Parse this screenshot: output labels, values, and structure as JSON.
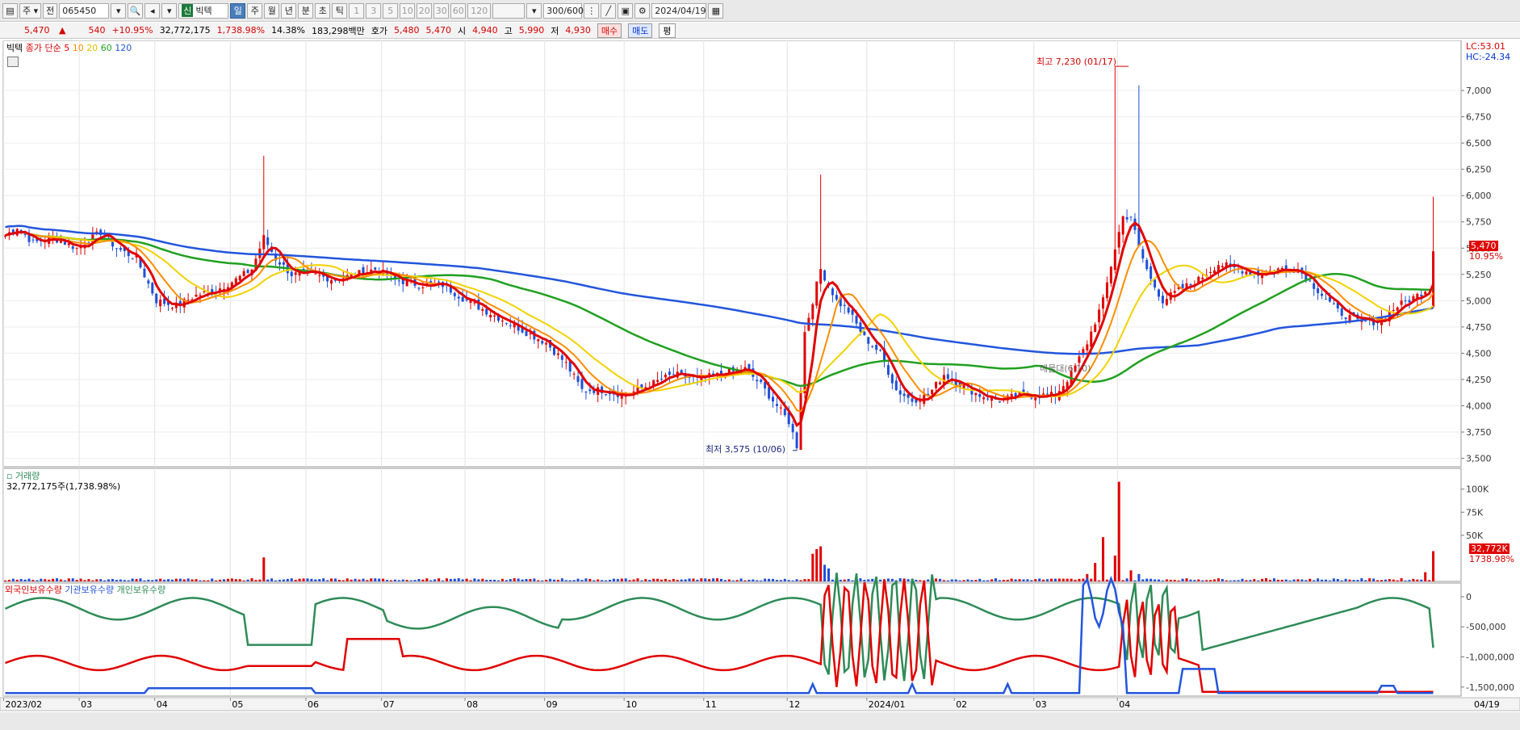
{
  "toolbar": {
    "period_type": "주",
    "code_prefix": "전",
    "stock_code": "065450",
    "market_badge": "신",
    "stock_name": "빅텍",
    "periods": [
      "일",
      "주",
      "월",
      "년",
      "분",
      "초",
      "틱"
    ],
    "selected_period": "일",
    "intervals": [
      "1",
      "3",
      "5",
      "10",
      "20",
      "30",
      "60",
      "120"
    ],
    "count": "300/600",
    "date": "2024/04/19"
  },
  "info": {
    "price": "5,470",
    "change": "540",
    "change_pct": "+10.95%",
    "volume": "32,772,175",
    "volume_ratio": "1,738.98%",
    "turnover": "14.38%",
    "amount": "183,298백만",
    "quote_label": "호가",
    "ask": "5,480",
    "bid": "5,470",
    "open_label": "시",
    "open": "4,940",
    "high_label": "고",
    "high": "5,990",
    "low_label": "저",
    "low": "4,930",
    "buy_button": "매수",
    "sell_button": "매도",
    "eval_button": "평"
  },
  "price_panel": {
    "legend_name": "빅텍",
    "legend_ma_label": "종가 단순",
    "ma_periods": [
      "5",
      "10",
      "20",
      "60",
      "120"
    ],
    "ma_colors": [
      "#e00000",
      "#ff8c00",
      "#f2d200",
      "#20a020",
      "#2255dd"
    ],
    "lc": "LC:53.01",
    "hc": "HC:-24.34",
    "max_label": "최고 7,230 (01/17)",
    "min_label": "최저 3,575 (10/06)",
    "faint_label": "매물대(6,10)",
    "current_price": "5,470",
    "current_pct": "10.95%"
  },
  "volume_panel": {
    "title": "거래량",
    "subtitle": "32,772,175주(1,738.98%)",
    "current": "32,772K",
    "current_pct": "1738.98%"
  },
  "holdings_panel": {
    "legends": [
      "외국인보유수량",
      "기관보유수량",
      "개인보유수량"
    ],
    "legend_colors": [
      "#e00000",
      "#2255dd",
      "#2e8b57"
    ]
  },
  "x_axis": {
    "labels": [
      "2023/02",
      "03",
      "04",
      "05",
      "06",
      "07",
      "08",
      "09",
      "10",
      "11",
      "12",
      "2024/01",
      "02",
      "03",
      "04"
    ],
    "end_label": "04/19"
  },
  "chart_data": {
    "type": "candlestick",
    "price_axis": {
      "ticks": [
        3500,
        3750,
        4000,
        4250,
        4500,
        4750,
        5000,
        5250,
        5500,
        5750,
        6000,
        6250,
        6500,
        6750,
        7000
      ],
      "range": [
        3420,
        7400
      ]
    },
    "volume_axis": {
      "ticks": [
        50000,
        75000,
        100000
      ],
      "unit": "K",
      "range": [
        0,
        112000
      ]
    },
    "holdings_axis": {
      "ticks": [
        0,
        -500000,
        -1000000,
        -1500000
      ],
      "range": [
        -1650000,
        120000
      ]
    },
    "anchors": [
      [
        0,
        5620
      ],
      [
        3,
        5700
      ],
      [
        7,
        5550
      ],
      [
        12,
        5600
      ],
      [
        18,
        5500
      ],
      [
        24,
        5650
      ],
      [
        28,
        5500
      ],
      [
        33,
        5400
      ],
      [
        38,
        5000
      ],
      [
        43,
        4950
      ],
      [
        48,
        5050
      ],
      [
        53,
        5100
      ],
      [
        58,
        5200
      ],
      [
        62,
        5300
      ],
      [
        65,
        5600
      ],
      [
        68,
        5400
      ],
      [
        72,
        5250
      ],
      [
        77,
        5250
      ],
      [
        83,
        5200
      ],
      [
        88,
        5250
      ],
      [
        93,
        5300
      ],
      [
        98,
        5200
      ],
      [
        104,
        5150
      ],
      [
        110,
        5150
      ],
      [
        116,
        5000
      ],
      [
        121,
        4900
      ],
      [
        126,
        4800
      ],
      [
        131,
        4700
      ],
      [
        136,
        4600
      ],
      [
        141,
        4400
      ],
      [
        145,
        4150
      ],
      [
        150,
        4150
      ],
      [
        156,
        4100
      ],
      [
        162,
        4200
      ],
      [
        168,
        4300
      ],
      [
        174,
        4250
      ],
      [
        180,
        4300
      ],
      [
        186,
        4350
      ],
      [
        190,
        4200
      ],
      [
        194,
        4000
      ],
      [
        197,
        3850
      ],
      [
        199,
        3620
      ],
      [
        201,
        4700
      ],
      [
        205,
        5300
      ],
      [
        209,
        5000
      ],
      [
        212,
        4900
      ],
      [
        216,
        4650
      ],
      [
        220,
        4500
      ],
      [
        224,
        4150
      ],
      [
        228,
        4050
      ],
      [
        232,
        4100
      ],
      [
        236,
        4300
      ],
      [
        240,
        4200
      ],
      [
        245,
        4100
      ],
      [
        250,
        4050
      ],
      [
        255,
        4100
      ],
      [
        260,
        4100
      ],
      [
        264,
        4100
      ],
      [
        268,
        4300
      ],
      [
        272,
        4600
      ],
      [
        276,
        5000
      ],
      [
        279,
        5500
      ],
      [
        281,
        5800
      ],
      [
        283,
        5800
      ],
      [
        285,
        5500
      ],
      [
        288,
        5200
      ],
      [
        291,
        5000
      ],
      [
        295,
        5100
      ],
      [
        300,
        5200
      ],
      [
        305,
        5350
      ],
      [
        310,
        5300
      ],
      [
        315,
        5250
      ],
      [
        320,
        5300
      ],
      [
        325,
        5300
      ],
      [
        330,
        5100
      ],
      [
        335,
        4900
      ],
      [
        340,
        4800
      ],
      [
        345,
        4800
      ],
      [
        350,
        4950
      ],
      [
        355,
        5050
      ],
      [
        358,
        5130
      ],
      [
        359,
        5470
      ]
    ],
    "highs_lows": {
      "max": 7230,
      "max_date": "01/17",
      "min": 3575,
      "min_date": "10/06"
    },
    "last": {
      "open": 4940,
      "high": 5990,
      "low": 4930,
      "close": 5470,
      "volume_k": 32772
    }
  }
}
